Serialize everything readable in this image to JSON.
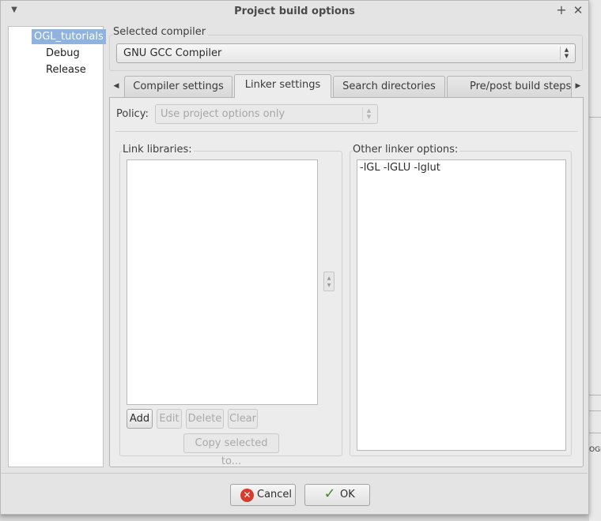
{
  "window": {
    "title": "Project build options"
  },
  "tree": {
    "items": [
      "OGL_tutorials",
      "Debug",
      "Release"
    ],
    "selected": "OGL_tutorials"
  },
  "compiler": {
    "label": "Selected compiler",
    "value": "GNU GCC Compiler"
  },
  "tabs": {
    "items": [
      "Compiler settings",
      "Linker settings",
      "Search directories",
      "Pre/post build steps"
    ],
    "active": "Linker settings"
  },
  "policy": {
    "label": "Policy:",
    "value": "Use project options only"
  },
  "link_libraries": {
    "label": "Link libraries:",
    "items": [],
    "buttons": {
      "add": "Add",
      "edit": "Edit",
      "delete": "Delete",
      "clear": "Clear",
      "copy": "Copy selected to..."
    }
  },
  "other_linker": {
    "label": "Other linker options:",
    "value": "-lGL -lGLU -lglut"
  },
  "footer": {
    "cancel": "Cancel",
    "ok": "OK"
  },
  "background_fragment": {
    "text": "OGL"
  },
  "colors": {
    "selection": "#8fb3de",
    "cancel_icon": "#d93a2b",
    "ok_icon": "#3f8f24"
  }
}
